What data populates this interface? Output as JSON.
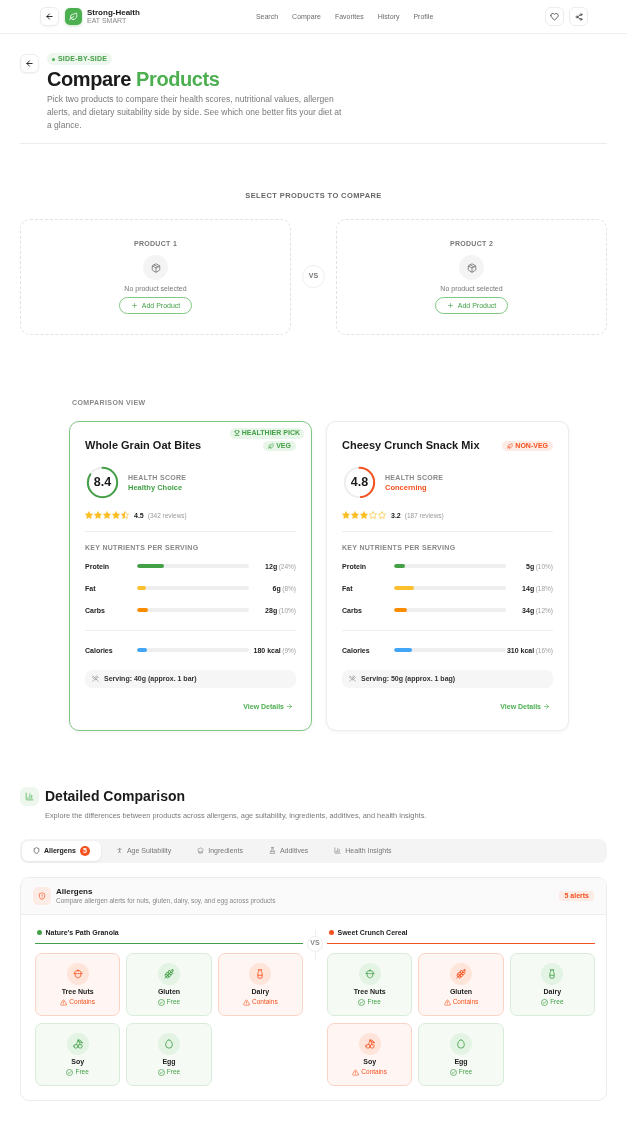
{
  "header": {
    "brand": {
      "name": "Strong-Health",
      "tagline": "EAT SMART"
    },
    "nav": [
      {
        "label": "Search"
      },
      {
        "label": "Compare"
      },
      {
        "label": "Favorites"
      },
      {
        "label": "History"
      },
      {
        "label": "Profile"
      }
    ]
  },
  "page_intro": {
    "badge": "SIDE-BY-SIDE",
    "title": "Compare",
    "title_accent": "Products",
    "description": "Pick two products to compare their health scores, nutritional values, allergen alerts, and dietary suitability side by side. See which one better fits your diet at a glance."
  },
  "selector": {
    "heading": "SELECT PRODUCTS TO COMPARE",
    "vs": "VS",
    "slots": [
      {
        "label": "PRODUCT 1",
        "empty_text": "No product selected",
        "button": "Add Product"
      },
      {
        "label": "PRODUCT 2",
        "empty_text": "No product selected",
        "button": "Add Product"
      }
    ]
  },
  "comparison": {
    "heading": "COMPARISON VIEW",
    "products": [
      {
        "name": "Whole Grain Oat Bites",
        "recommended": true,
        "pick_badge": "HEALTHIER PICK",
        "diet": {
          "kind": "veg",
          "label": "VEG"
        },
        "score": "8.4",
        "score_label": "HEALTH SCORE",
        "verdict": "Healthy Choice",
        "healthy": true,
        "stars": 4.5,
        "rating": "4.5",
        "reviews": "(342 reviews)",
        "nutrients_heading": "KEY NUTRIENTS PER SERVING",
        "nutrients": [
          {
            "kind": "macro",
            "name": "Protein",
            "value": "12g",
            "percent": "(24%)",
            "level": 0.24,
            "color": "#43a047"
          },
          {
            "kind": "macro",
            "name": "Fat",
            "value": "6g",
            "percent": "(8%)",
            "level": 0.08,
            "color": "#fbc02d"
          },
          {
            "kind": "macro",
            "name": "Carbs",
            "value": "28g",
            "percent": "(10%)",
            "level": 0.1,
            "color": "#fb8c00"
          },
          {
            "kind": "energy",
            "name": "Calories",
            "value": "180 kcal",
            "percent": "(9%)",
            "level": 0.09,
            "color": "#42a5f5"
          }
        ],
        "serving": "Serving: 40g (approx. 1 bar)",
        "link": "View Details"
      },
      {
        "name": "Cheesy Crunch Snack Mix",
        "recommended": false,
        "diet": {
          "kind": "non_veg",
          "label": "NON-VEG"
        },
        "score": "4.8",
        "score_label": "HEALTH SCORE",
        "verdict": "Concerning",
        "healthy": false,
        "stars": 3,
        "rating": "3.2",
        "reviews": "(187 reviews)",
        "nutrients_heading": "KEY NUTRIENTS PER SERVING",
        "nutrients": [
          {
            "kind": "macro",
            "name": "Protein",
            "value": "5g",
            "percent": "(10%)",
            "level": 0.1,
            "color": "#43a047"
          },
          {
            "kind": "macro",
            "name": "Fat",
            "value": "14g",
            "percent": "(18%)",
            "level": 0.18,
            "color": "#fbc02d"
          },
          {
            "kind": "macro",
            "name": "Carbs",
            "value": "34g",
            "percent": "(12%)",
            "level": 0.12,
            "color": "#fb8c00"
          },
          {
            "kind": "energy",
            "name": "Calories",
            "value": "310 kcal",
            "percent": "(16%)",
            "level": 0.16,
            "color": "#42a5f5"
          }
        ],
        "serving": "Serving: 50g (approx. 1 bag)",
        "link": "View Details"
      }
    ]
  },
  "detailed": {
    "title": "Detailed Comparison",
    "description": "Explore the differences between products across allergens, age suitability, ingredients, additives, and health insights.",
    "tabs": [
      {
        "label": "Allergens",
        "selected": true,
        "count": "5"
      },
      {
        "label": "Age Suitability",
        "selected": false
      },
      {
        "label": "Ingredients",
        "selected": false
      },
      {
        "label": "Additives",
        "selected": false
      },
      {
        "label": "Health Insights",
        "selected": false
      }
    ]
  },
  "allergens_panel": {
    "title": "Allergens",
    "description": "Compare allergen alerts for nuts, gluten, dairy, soy, and egg across products",
    "alerts": "5 alerts",
    "vs": "VS",
    "products": [
      {
        "name": "Nature's Path Granola",
        "color": "#43a047",
        "allergens": [
          {
            "name": "Tree Nuts",
            "contains": true,
            "status": "Contains"
          },
          {
            "name": "Gluten",
            "contains": false,
            "status": "Free"
          },
          {
            "name": "Dairy",
            "contains": true,
            "status": "Contains"
          },
          {
            "name": "Soy",
            "contains": false,
            "status": "Free"
          },
          {
            "name": "Egg",
            "contains": false,
            "status": "Free"
          }
        ]
      },
      {
        "name": "Sweet Crunch Cereal",
        "color": "#f4511e",
        "allergens": [
          {
            "name": "Tree Nuts",
            "contains": false,
            "status": "Free"
          },
          {
            "name": "Gluten",
            "contains": true,
            "status": "Contains"
          },
          {
            "name": "Dairy",
            "contains": false,
            "status": "Free"
          },
          {
            "name": "Soy",
            "contains": true,
            "status": "Contains"
          },
          {
            "name": "Egg",
            "contains": false,
            "status": "Free"
          }
        ]
      }
    ]
  }
}
